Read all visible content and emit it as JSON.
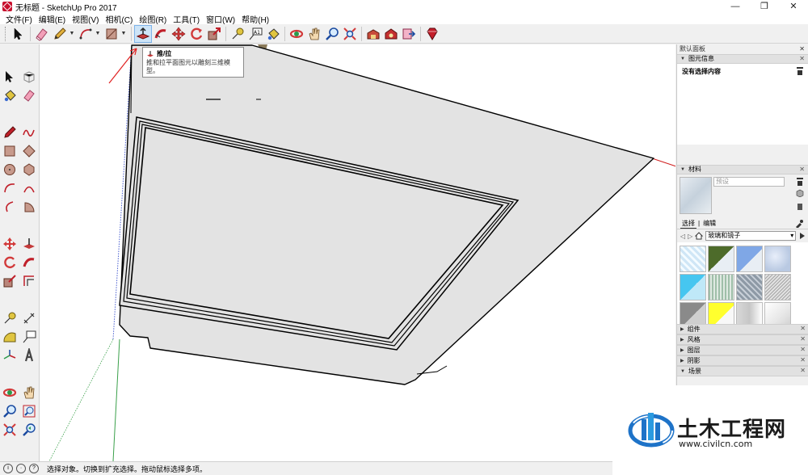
{
  "window": {
    "title": "无标题 - SketchUp Pro 2017"
  },
  "menu": [
    "文件(F)",
    "编辑(E)",
    "视图(V)",
    "相机(C)",
    "绘图(R)",
    "工具(T)",
    "窗口(W)",
    "帮助(H)"
  ],
  "tooltip": {
    "title": "推/拉",
    "body": "推和拉平面图元以雕刻三维模型。"
  },
  "tray": {
    "title": "默认面板",
    "entity_info": {
      "title": "图元信息",
      "empty_text": "没有选择内容"
    },
    "materials": {
      "title": "材料",
      "name_placeholder": "预设",
      "tabs": [
        "选择",
        "编辑"
      ],
      "library": "玻璃和镜子",
      "swatch_colors": [
        "#cfe6f6",
        "#4d6b2a",
        "#7fa7e6",
        "#b9c9e2",
        "#46c6f0",
        "#9fbfa9",
        "#8e9aa6",
        "#a6a6a6",
        "#8a8a8a",
        "#ffff2e",
        "#c6c6c6",
        "#e6e6e6"
      ]
    },
    "collapsed": [
      "组件",
      "风格",
      "图层",
      "阴影",
      "场景"
    ]
  },
  "status": {
    "text": "选择对象。切换到扩充选择。拖动鼠标选择多项。"
  },
  "watermark": {
    "name": "土木工程网",
    "url": "www.civilcn.com"
  }
}
